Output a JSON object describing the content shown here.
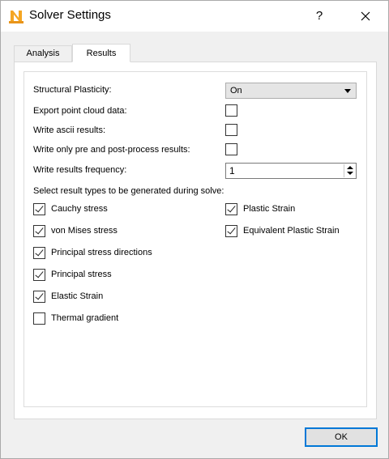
{
  "window": {
    "title": "Solver Settings",
    "help_label": "?"
  },
  "tabs": [
    {
      "label": "Analysis"
    },
    {
      "label": "Results"
    }
  ],
  "settings": {
    "structural_plasticity": {
      "label": "Structural Plasticity:",
      "value": "On"
    },
    "export_point_cloud": {
      "label": "Export point cloud data:",
      "checked": false
    },
    "write_ascii": {
      "label": "Write ascii results:",
      "checked": false
    },
    "write_pre_post": {
      "label": "Write only pre and post-process results:",
      "checked": false
    },
    "frequency": {
      "label": "Write results frequency:",
      "value": "1"
    }
  },
  "result_types": {
    "heading": "Select result types to be generated during solve:",
    "left": [
      {
        "label": "Cauchy stress",
        "checked": true
      },
      {
        "label": "von Mises stress",
        "checked": true
      },
      {
        "label": "Principal stress directions",
        "checked": true
      },
      {
        "label": "Principal stress",
        "checked": true
      },
      {
        "label": "Elastic Strain",
        "checked": true
      },
      {
        "label": "Thermal gradient",
        "checked": false
      }
    ],
    "right": [
      {
        "label": "Plastic Strain",
        "checked": true
      },
      {
        "label": "Equivalent Plastic Strain",
        "checked": true
      }
    ]
  },
  "footer": {
    "ok_label": "OK"
  },
  "icons": {
    "app": "n-app-icon",
    "close": "close-icon",
    "dropdown": "chevron-down-icon",
    "spinner": "spinner-arrows-icon"
  },
  "colors": {
    "accent": "#0078d7",
    "app_icon": "#f5a623"
  }
}
